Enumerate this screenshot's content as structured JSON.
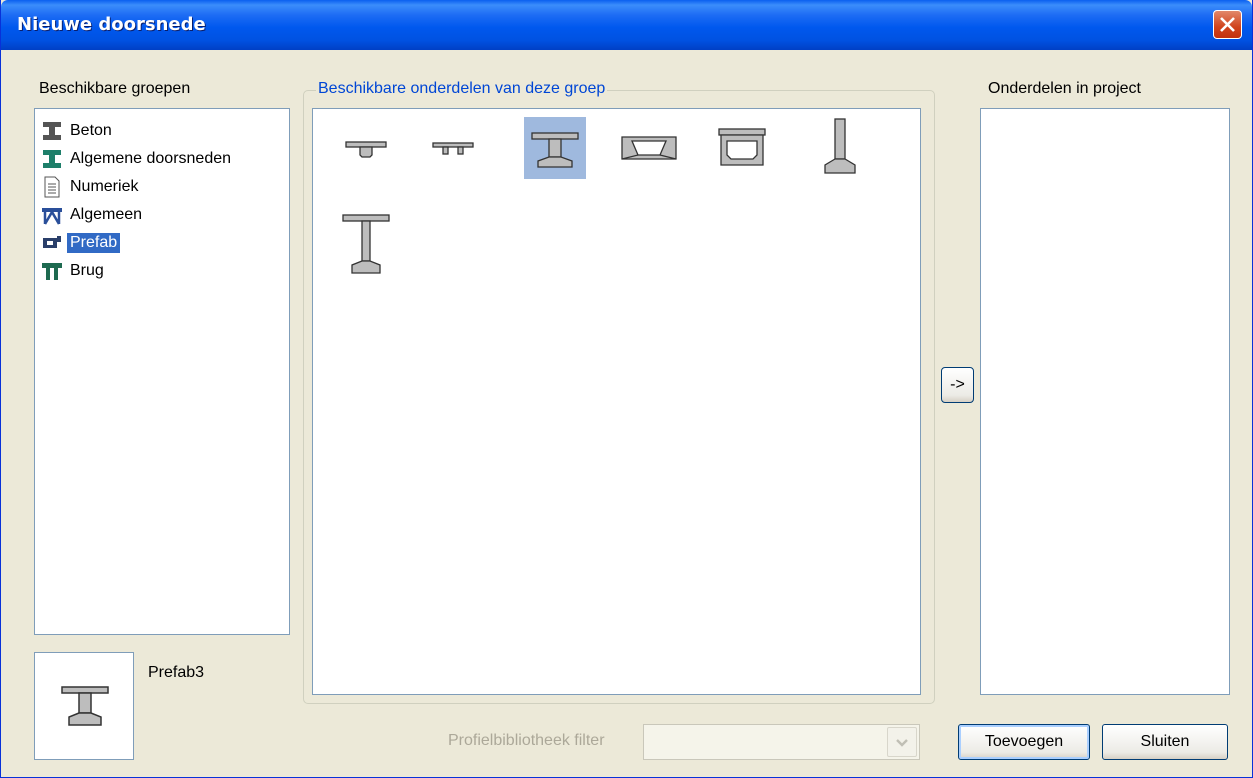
{
  "window": {
    "title": "Nieuwe doorsnede"
  },
  "groups": {
    "label": "Beschikbare groepen",
    "items": [
      {
        "label": "Beton",
        "icon": "beam-i-icon"
      },
      {
        "label": "Algemene doorsneden",
        "icon": "green-i-section-icon"
      },
      {
        "label": "Numeriek",
        "icon": "document-icon"
      },
      {
        "label": "Algemeen",
        "icon": "truss-icon"
      },
      {
        "label": "Prefab",
        "icon": "prefab-icon",
        "selected": true
      },
      {
        "label": "Brug",
        "icon": "bridge-icon"
      }
    ]
  },
  "parts": {
    "label": "Beschikbare onderdelen van deze groep",
    "items": [
      {
        "icon": "t-beam-icon"
      },
      {
        "icon": "double-t-icon"
      },
      {
        "icon": "i-beam-icon",
        "selected": true
      },
      {
        "icon": "trough-icon"
      },
      {
        "icon": "box-section-icon"
      },
      {
        "icon": "inverted-t-icon"
      },
      {
        "icon": "tall-i-beam-icon"
      }
    ]
  },
  "project": {
    "label": "Onderdelen in project"
  },
  "preview": {
    "name": "Prefab3",
    "icon": "i-beam-icon"
  },
  "filter": {
    "label": "Profielbibliotheek filter",
    "value": ""
  },
  "buttons": {
    "move": "->",
    "add": "Toevoegen",
    "close": "Sluiten"
  }
}
